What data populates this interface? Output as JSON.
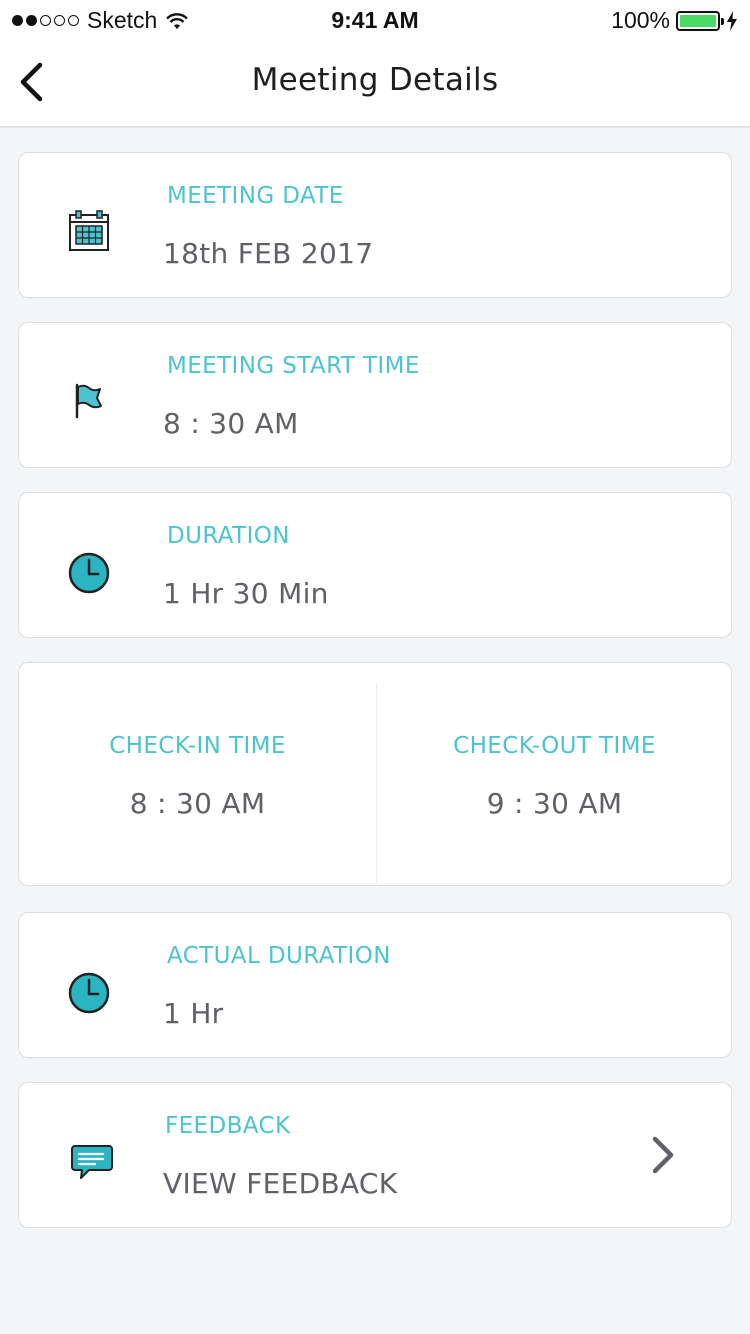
{
  "status_bar": {
    "carrier": "Sketch",
    "time": "9:41 AM",
    "battery": "100%"
  },
  "nav": {
    "title": "Meeting Details",
    "back_icon": "chevron-left-icon"
  },
  "meeting_date": {
    "label": "MEETING DATE",
    "value": "18th FEB 2017",
    "icon": "calendar-icon"
  },
  "start_time": {
    "label": "MEETING START TIME",
    "value": "8 : 30 AM",
    "icon": "flag-icon"
  },
  "duration": {
    "label": "DURATION",
    "value": "1 Hr 30 Min",
    "icon": "clock-icon"
  },
  "check_in": {
    "label": "CHECK-IN TIME",
    "value": "8 : 30 AM"
  },
  "check_out": {
    "label": "CHECK-OUT TIME",
    "value": "9 : 30 AM"
  },
  "actual_duration": {
    "label": "ACTUAL DURATION",
    "value": "1 Hr",
    "icon": "clock-icon"
  },
  "feedback": {
    "label": "FEEDBACK",
    "value": "VIEW FEEDBACK",
    "icon": "chat-icon"
  },
  "colors": {
    "accent": "#4cc4cf",
    "text": "#5f6166",
    "battery": "#4cd964"
  }
}
